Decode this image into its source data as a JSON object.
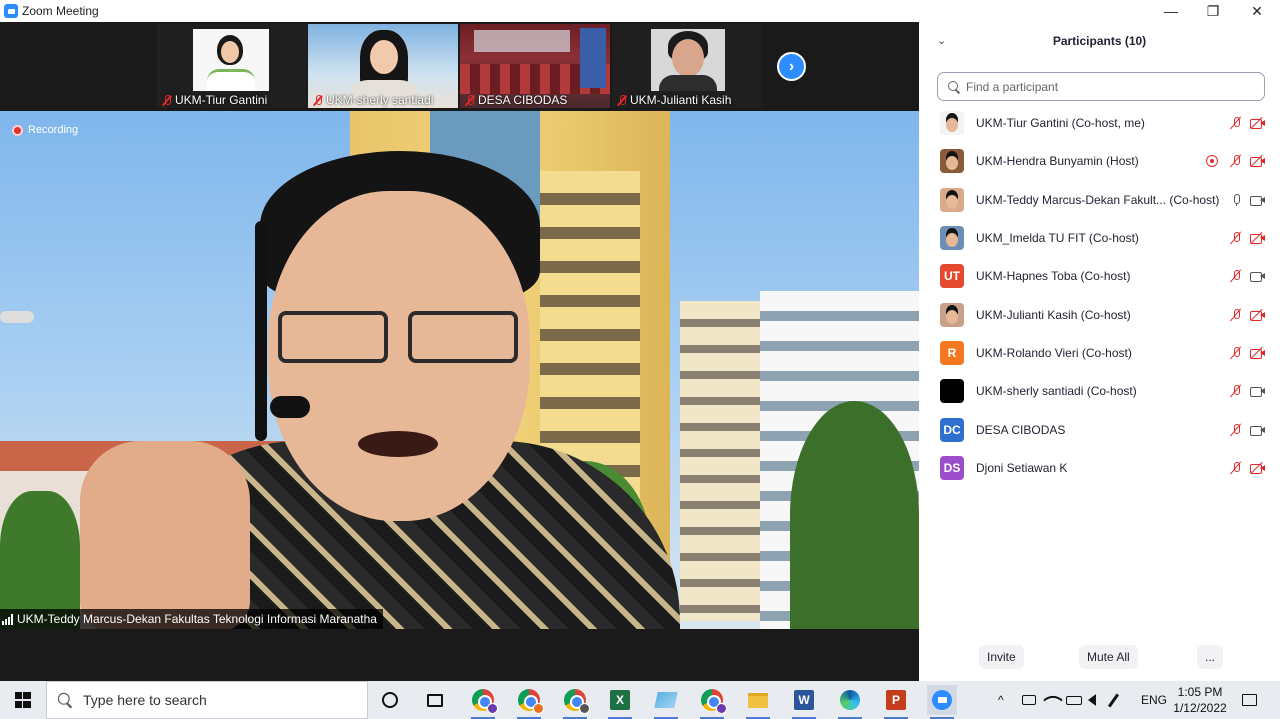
{
  "window": {
    "title": "Zoom Meeting",
    "minimize": "—",
    "maximize": "❐",
    "close": "✕"
  },
  "thumbnails": [
    {
      "name": "UKM-Tiur Gantini",
      "muted": true
    },
    {
      "name": "UKM-sherly santiadi",
      "muted": true
    },
    {
      "name": "DESA CIBODAS",
      "muted": true
    },
    {
      "name": "UKM-Julianti Kasih",
      "muted": true
    }
  ],
  "next_arrow": "›",
  "main_video": {
    "recording_label": "Recording",
    "speaker_name": "UKM-Teddy Marcus-Dekan Fakultas Teknologi Informasi Maranatha"
  },
  "panel": {
    "collapse_icon": "chevron-down-icon",
    "collapse_glyph": "⌄",
    "title": "Participants (10)",
    "search_placeholder": "Find a participant",
    "participants": [
      {
        "name": "UKM-Tiur Gantini (Co-host, me)",
        "avatar_type": "photo",
        "avatar_color": "#f3f3f3",
        "mic": "muted",
        "cam": "muted"
      },
      {
        "name": "UKM-Hendra Bunyamin (Host)",
        "avatar_type": "photo",
        "avatar_color": "#8a5a3a",
        "mic": "muted",
        "cam": "muted",
        "recording": true
      },
      {
        "name": "UKM-Teddy Marcus-Dekan Fakult...  (Co-host)",
        "avatar_type": "photo",
        "avatar_color": "#d9a98a",
        "mic": "on",
        "cam": "on"
      },
      {
        "name": "UKM_Imelda TU FIT (Co-host)",
        "avatar_type": "photo",
        "avatar_color": "#6b8fb5",
        "mic": "muted",
        "cam": "muted"
      },
      {
        "name": "UKM-Hapnes Toba (Co-host)",
        "avatar_type": "initials",
        "initials": "UT",
        "avatar_color": "#e2492f",
        "mic": "muted",
        "cam": "on"
      },
      {
        "name": "UKM-Julianti Kasih (Co-host)",
        "avatar_type": "photo",
        "avatar_color": "#c9a089",
        "mic": "muted",
        "cam": "muted"
      },
      {
        "name": "UKM-Rolando Vieri (Co-host)",
        "avatar_type": "initials",
        "initials": "R",
        "avatar_color": "#f2771f",
        "mic": "muted",
        "cam": "muted"
      },
      {
        "name": "UKM-sherly santiadi (Co-host)",
        "avatar_type": "photo",
        "avatar_color": "#000000",
        "mic": "muted",
        "cam": "on"
      },
      {
        "name": "DESA CIBODAS",
        "avatar_type": "initials",
        "initials": "DC",
        "avatar_color": "#2e6fd0",
        "mic": "muted",
        "cam": "on"
      },
      {
        "name": "Djoni Setiawan K",
        "avatar_type": "initials",
        "initials": "DS",
        "avatar_color": "#9b4dca",
        "mic": "muted",
        "cam": "muted"
      }
    ],
    "buttons": {
      "invite": "Invite",
      "mute_all": "Mute All",
      "more": "..."
    }
  },
  "taskbar": {
    "search_placeholder": "Type here to search",
    "language": "ENG",
    "time": "1:05 PM",
    "date": "1/12/2022",
    "tray_chevron": "^"
  }
}
